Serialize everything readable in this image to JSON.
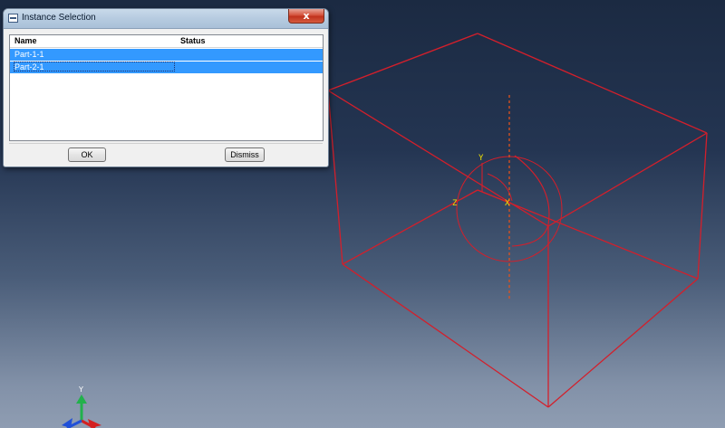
{
  "dialog": {
    "title": "Instance Selection",
    "close_glyph": "x",
    "columns": {
      "name": "Name",
      "status": "Status"
    },
    "rows": [
      {
        "name": "Part-1-1",
        "status": ""
      },
      {
        "name": "Part-2-1",
        "status": ""
      }
    ],
    "ok_label": "OK",
    "dismiss_label": "Dismiss"
  },
  "viewport": {
    "csys_labels": {
      "y": "Y",
      "z": "Z",
      "x": "X"
    },
    "triad_labels": {
      "y": "Y"
    },
    "colors": {
      "geometry": "#d31f2b",
      "axis_dashed": "#e0521c",
      "csys_label": "#f0e000",
      "triad_y": "#22b14c",
      "triad_x": "#d42020",
      "triad_z": "#2050d8"
    }
  },
  "icons": {
    "title_icon": "window-menu-icon",
    "close_icon": "close-icon"
  }
}
